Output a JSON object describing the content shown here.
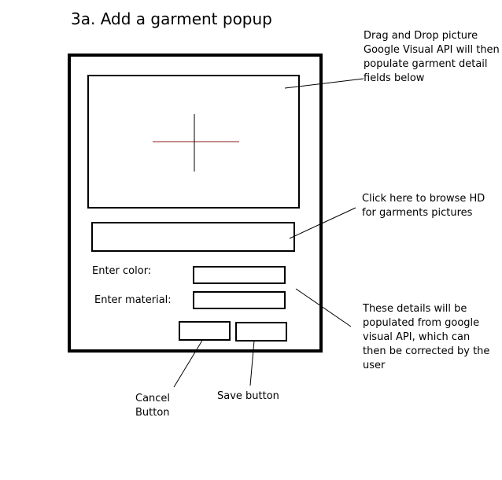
{
  "title": "3a. Add a garment popup",
  "form": {
    "color_label": "Enter color:",
    "material_label": "Enter material:"
  },
  "annotations": {
    "drop": "Drag and Drop picture\nGoogle Visual API will then\npopulate garment detail\nfields below",
    "browse": "Click here to browse HD\nfor garments pictures",
    "details": "These details will be\npopulated from google\nvisual API, which can\nthen be corrected by the\nuser",
    "cancel": "Cancel\nButton",
    "save": "Save button"
  },
  "colors": {
    "crosshair_horizontal": "#8b1a1a",
    "crosshair_vertical": "#000000"
  }
}
